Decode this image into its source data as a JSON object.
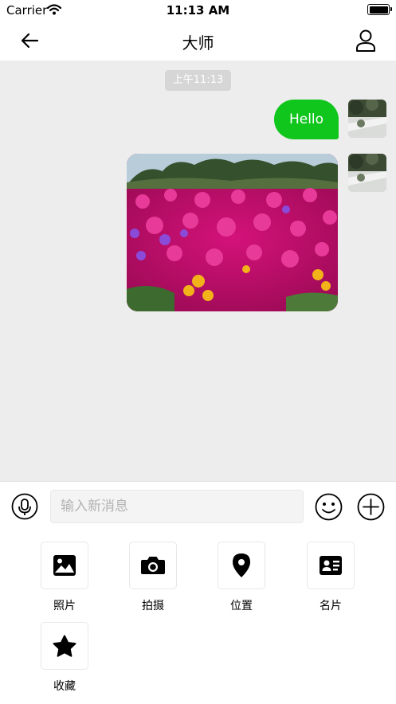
{
  "status_bar": {
    "carrier": "Carrier",
    "time": "11:13 AM"
  },
  "nav": {
    "title": "大师",
    "back_icon": "arrow-left-icon",
    "profile_icon": "user-icon"
  },
  "chat": {
    "timestamp": "上午11:13",
    "messages": [
      {
        "type": "text",
        "sender": "self",
        "text": "Hello",
        "bubble_color": "#10c61d"
      },
      {
        "type": "image",
        "sender": "self",
        "description_icon": "photo-flowers"
      }
    ]
  },
  "input_bar": {
    "placeholder": "输入新消息",
    "voice_icon": "microphone-icon",
    "emoji_icon": "smiley-icon",
    "plus_icon": "plus-circle-icon"
  },
  "tools": [
    {
      "label": "照片",
      "icon": "image-icon"
    },
    {
      "label": "拍摄",
      "icon": "camera-icon"
    },
    {
      "label": "位置",
      "icon": "location-pin-icon"
    },
    {
      "label": "名片",
      "icon": "contact-card-icon"
    },
    {
      "label": "收藏",
      "icon": "star-icon"
    }
  ],
  "colors": {
    "accent": "#10c61d",
    "chat_bg": "#ededed",
    "timestamp_bg": "#d6d6d6"
  }
}
